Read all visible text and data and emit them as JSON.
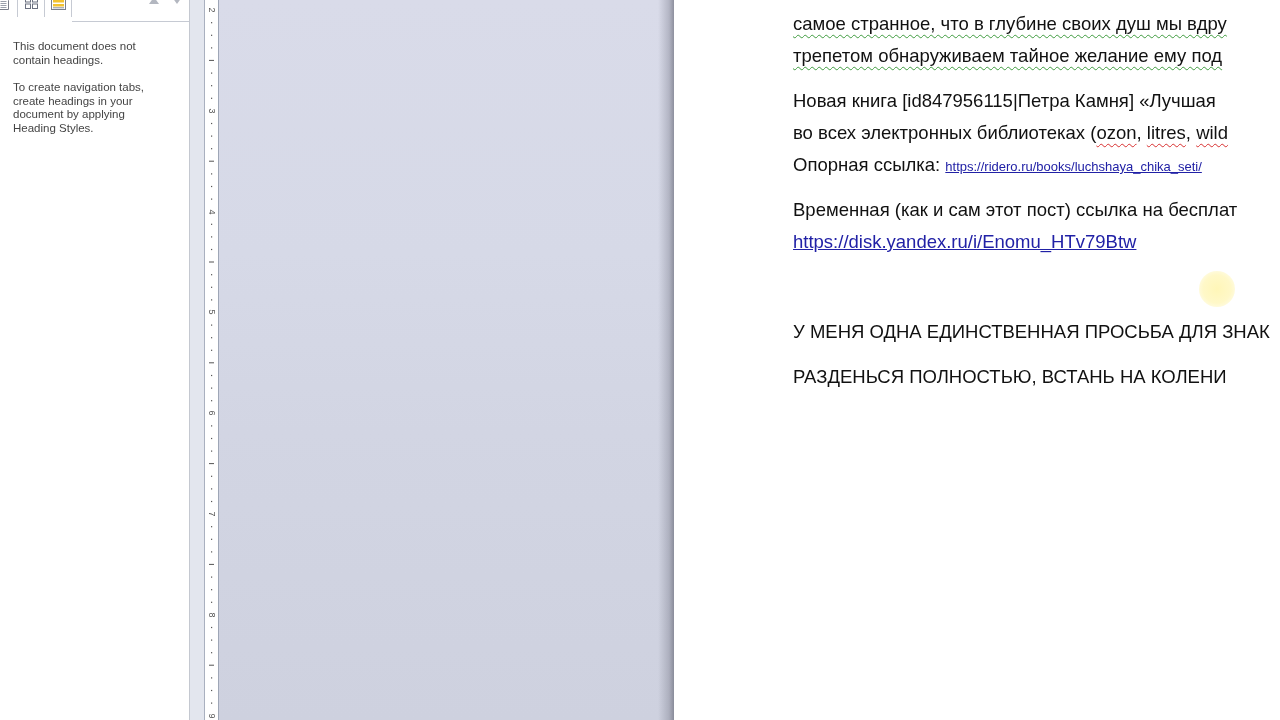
{
  "navigation_pane": {
    "messages": [
      "This document does not contain headings.",
      "To create navigation tabs, create headings in your document by applying Heading Styles."
    ]
  },
  "ruler": {
    "labels": [
      "2",
      "3",
      "4",
      "5",
      "6",
      "7",
      "8",
      "9"
    ]
  },
  "document": {
    "paragraphs": [
      {
        "kind": "text",
        "lines": [
          {
            "grammar_flag": true,
            "segments": [
              {
                "kind": "text",
                "text": "самое странное, что в глубине своих душ мы вдру"
              }
            ]
          },
          {
            "grammar_flag": true,
            "segments": [
              {
                "kind": "text",
                "text": "трепетом обнаруживаем тайное желание ему под"
              }
            ]
          }
        ]
      },
      {
        "kind": "text",
        "lines": [
          {
            "grammar_flag": false,
            "segments": [
              {
                "kind": "text",
                "text": "Новая книга [id847956115|Петра Камня] «Лучшая"
              }
            ]
          },
          {
            "grammar_flag": false,
            "segments": [
              {
                "kind": "text",
                "text": "во всех электронных библиотеках ("
              },
              {
                "kind": "misspelled",
                "text": "ozon"
              },
              {
                "kind": "text",
                "text": ", "
              },
              {
                "kind": "misspelled",
                "text": "litres"
              },
              {
                "kind": "text",
                "text": ", "
              },
              {
                "kind": "misspelled",
                "text": "wild"
              }
            ]
          },
          {
            "grammar_flag": false,
            "segments": [
              {
                "kind": "text",
                "text": "Опорная ссылка: "
              },
              {
                "kind": "small_link",
                "text": "https://ridero.ru/books/luchshaya_chika_seti/"
              }
            ]
          }
        ]
      },
      {
        "kind": "text",
        "lines": [
          {
            "grammar_flag": false,
            "segments": [
              {
                "kind": "text",
                "text": "Временная (как и сам этот пост) ссылка на бесплат"
              }
            ]
          },
          {
            "grammar_flag": false,
            "segments": [
              {
                "kind": "link",
                "text": "https://disk.yandex.ru/i/Enomu_HTv79Btw"
              }
            ]
          }
        ]
      },
      {
        "kind": "blank"
      },
      {
        "kind": "text",
        "lines": [
          {
            "grammar_flag": false,
            "segments": [
              {
                "kind": "text",
                "text": "У МЕНЯ ОДНА ЕДИНСТВЕННАЯ ПРОСЬБА ДЛЯ ЗНАК"
              }
            ]
          }
        ]
      },
      {
        "kind": "text",
        "lines": [
          {
            "grammar_flag": false,
            "segments": [
              {
                "kind": "text",
                "text": "РАЗДЕНЬСЯ ПОЛНОСТЬЮ, ВСТАНЬ НА КОЛЕНИ"
              }
            ]
          }
        ]
      }
    ]
  }
}
